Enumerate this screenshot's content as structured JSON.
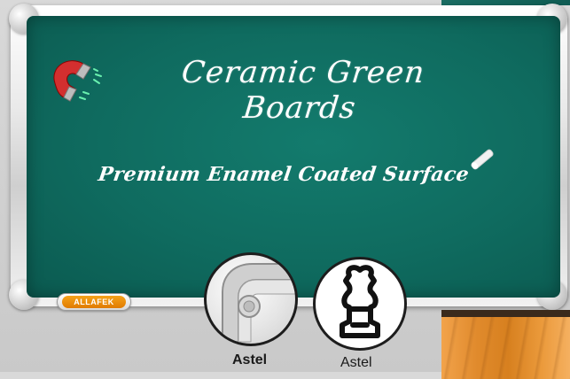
{
  "board": {
    "title": "Ceramic Green Boards",
    "subtitle": "Premium Enamel Coated Surface"
  },
  "brand": {
    "name": "ALLAFEK"
  },
  "profiles": [
    {
      "label": "Astel"
    },
    {
      "label": "Astel"
    }
  ],
  "colors": {
    "board": "#0f6b5f",
    "frame": "#d9d9d9",
    "badge": "#f39c12",
    "wood": "#e08a2c"
  },
  "icons": [
    "magnet-icon",
    "chalk-icon"
  ]
}
